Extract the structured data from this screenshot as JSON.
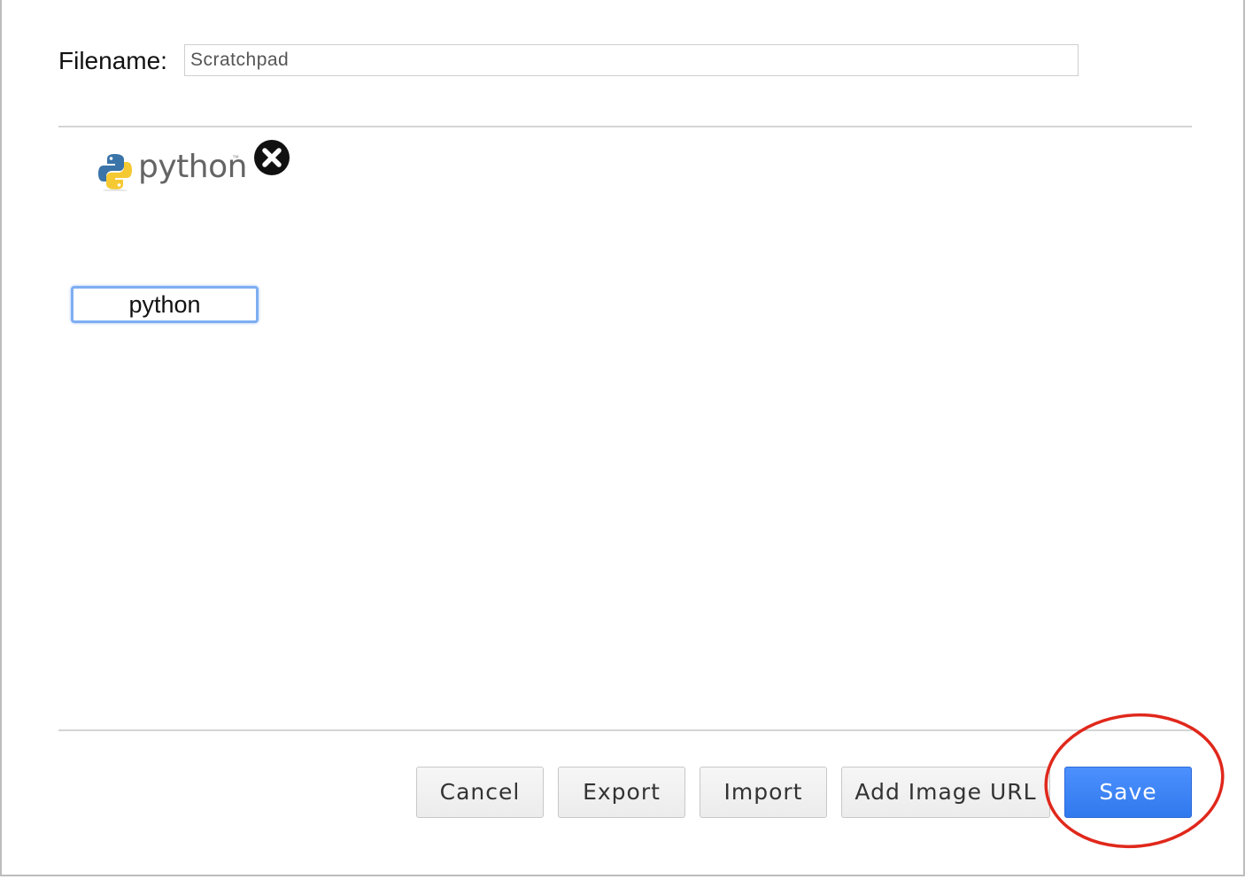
{
  "filename": {
    "label": "Filename:",
    "value": "Scratchpad"
  },
  "library": {
    "item_wordmark": "python",
    "item_trademark": "™",
    "item_logo_icon": "python-logo-icon",
    "delete_icon": "close-circle-icon",
    "name_input_value": "python"
  },
  "buttons": {
    "cancel": "Cancel",
    "export": "Export",
    "import": "Import",
    "add_image_url": "Add Image URL",
    "save": "Save"
  },
  "colors": {
    "save_button": "#3c8af0",
    "highlight_ellipse": "#e0281c",
    "input_focus": "#7eaef2"
  }
}
